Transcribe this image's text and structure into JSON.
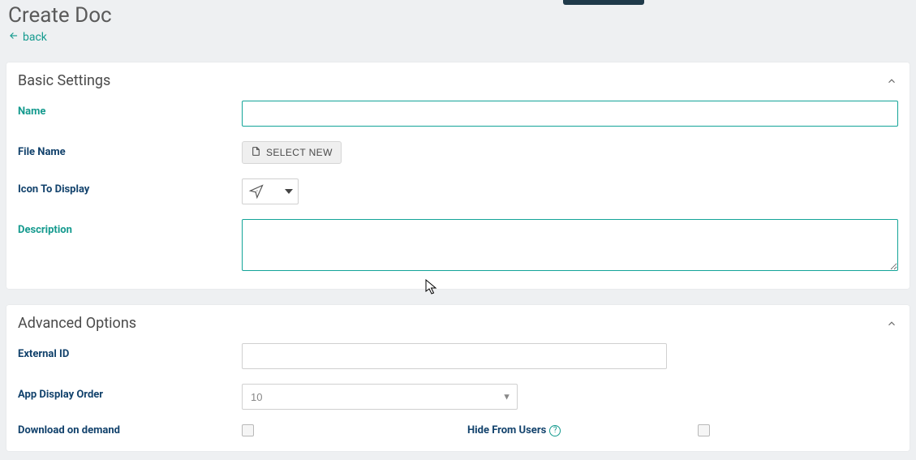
{
  "header": {
    "title": "Create Doc",
    "back_label": "back"
  },
  "basic": {
    "title": "Basic Settings",
    "name_label": "Name",
    "name_value": "",
    "file_name_label": "File Name",
    "select_new_label": "SELECT NEW",
    "icon_label": "Icon To Display",
    "icon_name": "paper-plane-icon",
    "description_label": "Description",
    "description_value": ""
  },
  "advanced": {
    "title": "Advanced Options",
    "external_id_label": "External ID",
    "external_id_value": "",
    "order_label": "App Display Order",
    "order_value": "10",
    "download_label": "Download on demand",
    "download_checked": false,
    "hide_label": "Hide From Users",
    "hide_checked": false
  }
}
